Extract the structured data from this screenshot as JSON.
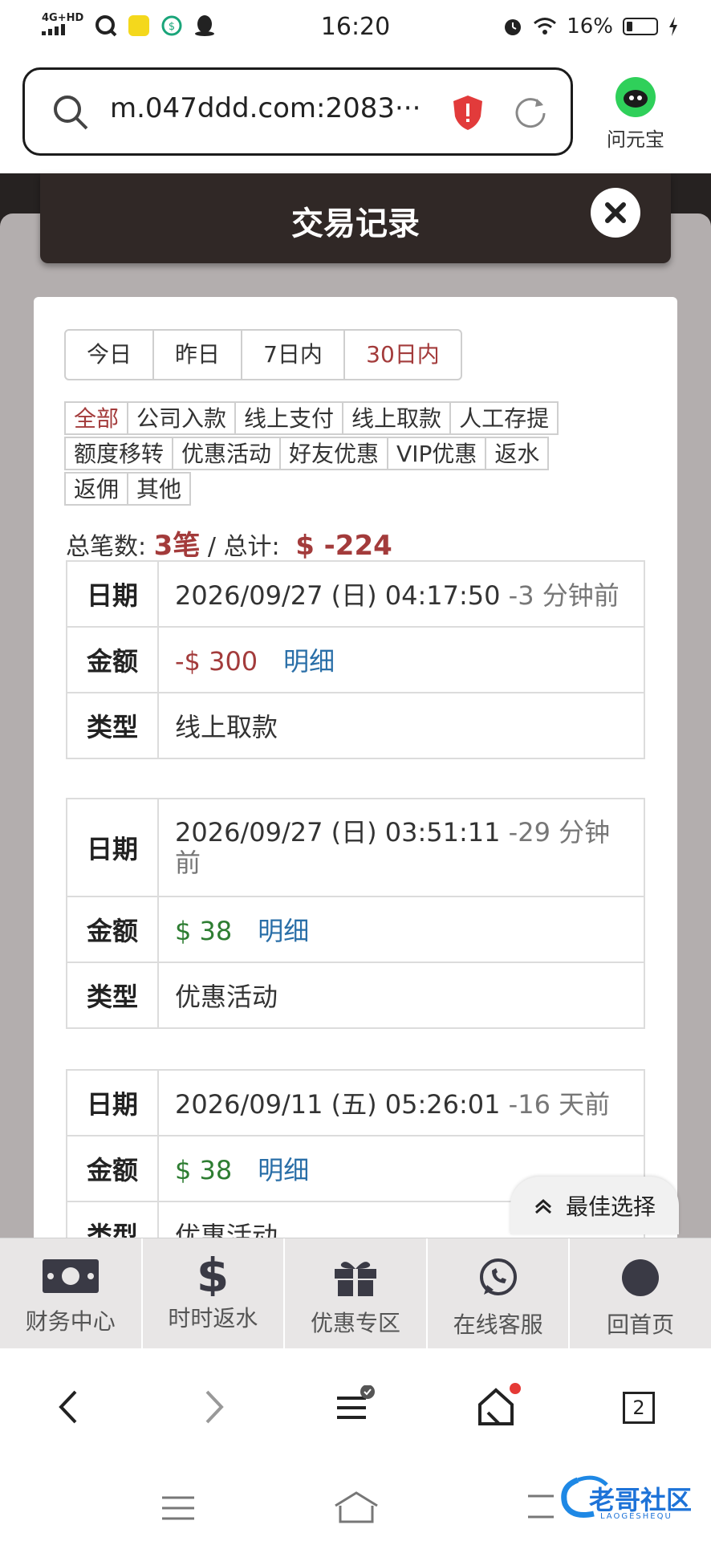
{
  "status_bar": {
    "network": "4G+HD",
    "signal_label": "4G",
    "time": "16:20",
    "battery_pct": "16%"
  },
  "address_bar": {
    "url": "m.047ddd.com:2083···"
  },
  "assistant": {
    "label": "问元宝"
  },
  "modal": {
    "title": "交易记录"
  },
  "filters": {
    "ranges": [
      "今日",
      "昨日",
      "7日内",
      "30日内"
    ],
    "active_range": "30日内",
    "types_row1": [
      "全部",
      "公司入款",
      "线上支付",
      "线上取款",
      "人工存提"
    ],
    "types_row2": [
      "额度移转",
      "优惠活动",
      "好友优惠",
      "VIP优惠",
      "返水"
    ],
    "types_row3": [
      "返佣",
      "其他"
    ],
    "active_type": "全部"
  },
  "summary": {
    "count_label": "总笔数:",
    "count_value": "3笔",
    "separator": "/",
    "total_label": "总计:",
    "total_value": "$ -224"
  },
  "labels": {
    "date": "日期",
    "amount": "金额",
    "type": "类型",
    "detail": "明细"
  },
  "records": [
    {
      "date": "2026/09/27 (日) 04:17:50",
      "ago": "-3 分钟前",
      "amount": "-$ 300",
      "type": "线上取款"
    },
    {
      "date": "2026/09/27 (日) 03:51:11",
      "ago": "-29 分钟前",
      "amount": "$ 38",
      "type": "优惠活动"
    },
    {
      "date": "2026/09/11 (五) 05:26:01",
      "ago": "-16 天前",
      "amount": "$ 38",
      "type": "优惠活动"
    }
  ],
  "float_button": {
    "label": "最佳选择"
  },
  "bottom_nav": [
    "财务中心",
    "时时返水",
    "优惠专区",
    "在线客服",
    "回首页"
  ],
  "browser_bar": {
    "tab_count": "2"
  },
  "watermark": {
    "text": "老哥社区",
    "subtext": "LAOGESHEQU"
  },
  "colors": {
    "accent_red": "#a33b3b",
    "positive_green": "#2e7d32",
    "link_blue": "#2a6fa8",
    "header_bg": "#302826"
  }
}
